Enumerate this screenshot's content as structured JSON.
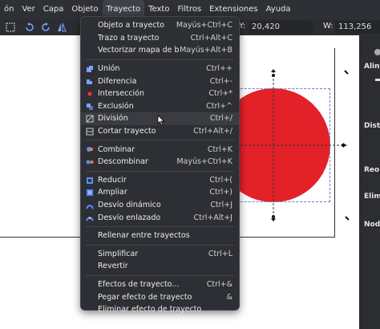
{
  "menubar": {
    "items": [
      {
        "label": "ón"
      },
      {
        "label": "Ver"
      },
      {
        "label": "Capa"
      },
      {
        "label": "Objeto"
      },
      {
        "label": "Trayecto",
        "active": true
      },
      {
        "label": "Texto"
      },
      {
        "label": "Filtros"
      },
      {
        "label": "Extensiones"
      },
      {
        "label": "Ayuda"
      }
    ]
  },
  "toolbar": {
    "y_label": "Y:",
    "y_value": "20,420",
    "w_label": "W:",
    "w_value": "113,256"
  },
  "panel": {
    "labels": [
      "Aline",
      "Distr",
      "Reor",
      "Elimi",
      "Nodo"
    ]
  },
  "colors": {
    "circle": "#e32129",
    "selection": "#6d7fd1",
    "menu_bg": "#2d2f34"
  },
  "menu": {
    "groups": [
      [
        {
          "label": "Objeto a trayecto",
          "shortcut": "Mayús+Ctrl+C",
          "icon": "none"
        },
        {
          "label": "Trazo a trayecto",
          "shortcut": "Ctrl+Alt+C",
          "icon": "none"
        },
        {
          "label": "Vectorizar mapa de bits...",
          "shortcut": "Mayús+Alt+B",
          "icon": "none"
        }
      ],
      [
        {
          "label": "Unión",
          "shortcut": "Ctrl++",
          "icon": "union-icon"
        },
        {
          "label": "Diferencia",
          "shortcut": "Ctrl+-",
          "icon": "difference-icon"
        },
        {
          "label": "Intersección",
          "shortcut": "Ctrl+*",
          "icon": "intersection-icon"
        },
        {
          "label": "Exclusión",
          "shortcut": "Ctrl+^",
          "icon": "exclusion-icon"
        },
        {
          "label": "División",
          "shortcut": "Ctrl+/",
          "icon": "division-icon",
          "hover": true
        },
        {
          "label": "Cortar trayecto",
          "shortcut": "Ctrl+Alt+/",
          "icon": "cut-path-icon"
        }
      ],
      [
        {
          "label": "Combinar",
          "shortcut": "Ctrl+K",
          "icon": "combine-icon"
        },
        {
          "label": "Descombinar",
          "shortcut": "Mayús+Ctrl+K",
          "icon": "break-apart-icon"
        }
      ],
      [
        {
          "label": "Reducir",
          "shortcut": "Ctrl+(",
          "icon": "inset-icon"
        },
        {
          "label": "Ampliar",
          "shortcut": "Ctrl+)",
          "icon": "outset-icon"
        },
        {
          "label": "Desvío dinámico",
          "shortcut": "Ctrl+J",
          "icon": "dynamic-offset-icon"
        },
        {
          "label": "Desvío enlazado",
          "shortcut": "Ctrl+Alt+J",
          "icon": "linked-offset-icon"
        }
      ],
      [
        {
          "label": "Rellenar entre trayectos",
          "shortcut": "",
          "icon": "none"
        }
      ],
      [
        {
          "label": "Simplificar",
          "shortcut": "Ctrl+L",
          "icon": "none"
        },
        {
          "label": "Revertir",
          "shortcut": "",
          "icon": "none"
        }
      ],
      [
        {
          "label": "Efectos de trayecto...",
          "shortcut": "Ctrl+&",
          "icon": "none"
        },
        {
          "label": "Pegar efecto de trayecto",
          "shortcut": "&",
          "icon": "none"
        },
        {
          "label": "Eliminar efecto de trayecto",
          "shortcut": "",
          "icon": "none"
        }
      ]
    ]
  }
}
